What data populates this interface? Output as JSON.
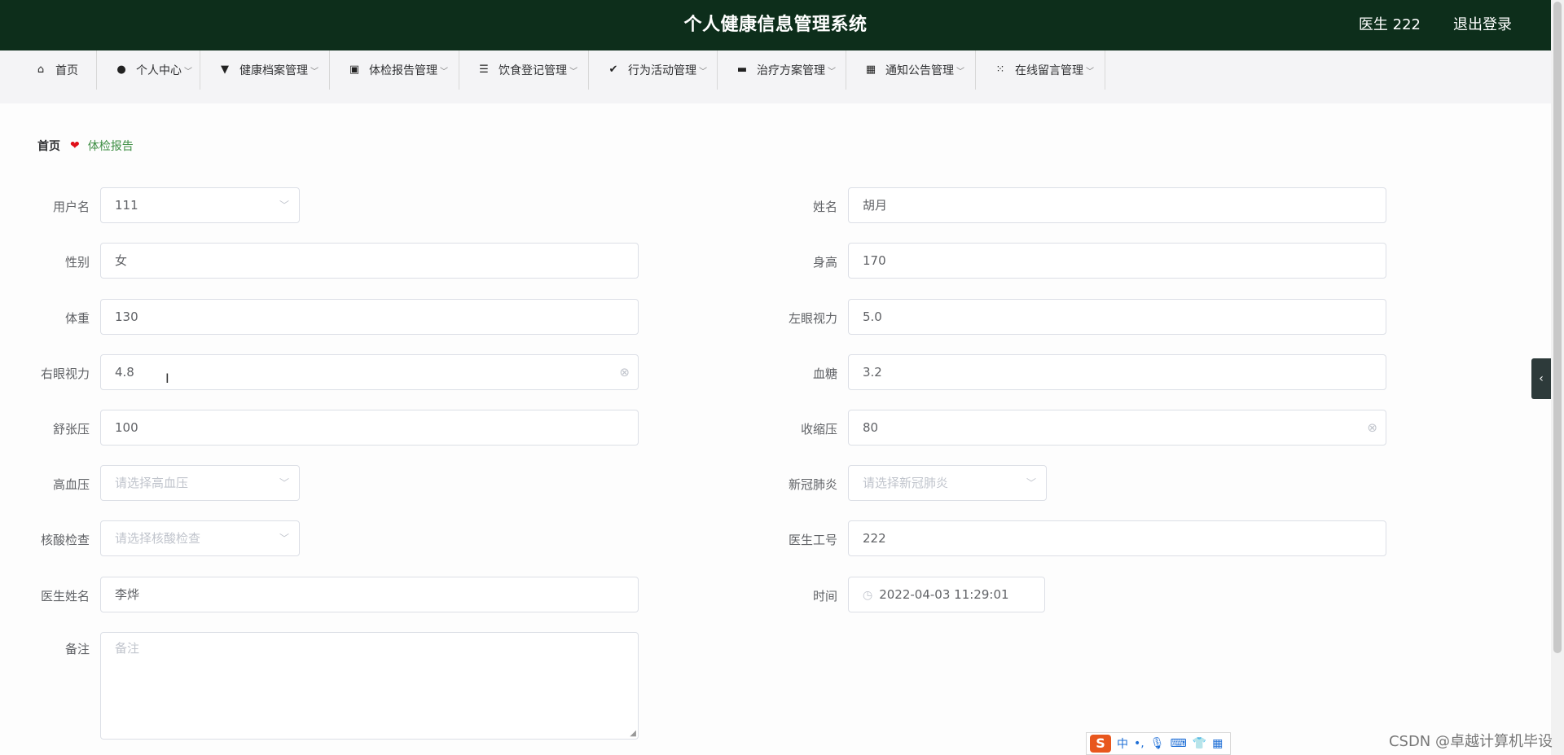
{
  "header": {
    "title": "个人健康信息管理系统",
    "user": "医生 222",
    "logout": "退出登录"
  },
  "nav": {
    "items": [
      {
        "label": "首页",
        "icon": "home-icon"
      },
      {
        "label": "个人中心",
        "icon": "person-icon"
      },
      {
        "label": "健康档案管理",
        "icon": "stamp-icon"
      },
      {
        "label": "体检报告管理",
        "icon": "clipboard-icon"
      },
      {
        "label": "饮食登记管理",
        "icon": "list-icon"
      },
      {
        "label": "行为活动管理",
        "icon": "check-clipboard-icon"
      },
      {
        "label": "治疗方案管理",
        "icon": "monitor-icon"
      },
      {
        "label": "通知公告管理",
        "icon": "grid-icon"
      },
      {
        "label": "在线留言管理",
        "icon": "apps-icon"
      }
    ]
  },
  "breadcrumb": {
    "home": "首页",
    "current": "体检报告"
  },
  "form": {
    "username": {
      "label": "用户名",
      "value": "111"
    },
    "name": {
      "label": "姓名",
      "value": "胡月"
    },
    "gender": {
      "label": "性别",
      "value": "女"
    },
    "height": {
      "label": "身高",
      "value": "170"
    },
    "weight": {
      "label": "体重",
      "value": "130"
    },
    "left_vision": {
      "label": "左眼视力",
      "value": "5.0"
    },
    "right_vision": {
      "label": "右眼视力",
      "value": "4.8"
    },
    "blood_sugar": {
      "label": "血糖",
      "value": "3.2"
    },
    "diastolic": {
      "label": "舒张压",
      "value": "100"
    },
    "systolic": {
      "label": "收缩压",
      "value": "80"
    },
    "hypertension": {
      "label": "高血压",
      "placeholder": "请选择高血压"
    },
    "covid": {
      "label": "新冠肺炎",
      "placeholder": "请选择新冠肺炎"
    },
    "nucleic": {
      "label": "核酸检查",
      "placeholder": "请选择核酸检查"
    },
    "doctor_id": {
      "label": "医生工号",
      "value": "222"
    },
    "doctor_name": {
      "label": "医生姓名",
      "value": "李烨"
    },
    "time": {
      "label": "时间",
      "value": "2022-04-03 11:29:01"
    },
    "remark": {
      "label": "备注",
      "placeholder": "备注"
    }
  },
  "ime": {
    "lang": "中"
  },
  "watermark": "CSDN @卓越计算机毕设"
}
